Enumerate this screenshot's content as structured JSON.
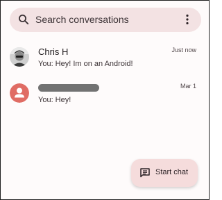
{
  "search": {
    "placeholder": "Search conversations",
    "icon": "search-icon",
    "menu_icon": "more-vert-icon"
  },
  "conversations": [
    {
      "name": "Chris H",
      "snippet": "You: Hey! Im on an Android!",
      "time": "Just now",
      "avatar": "photo-avatar"
    },
    {
      "name": "",
      "snippet": "You: Hey!",
      "time": "Mar 1",
      "avatar": "person-avatar",
      "avatar_color": "#e06c64"
    }
  ],
  "fab": {
    "label": "Start chat",
    "icon": "chat-icon"
  },
  "colors": {
    "surface": "#fefbfb",
    "search_bg": "#f3e2e3",
    "fab_bg": "#f5dcdc",
    "redaction": "#727272"
  }
}
